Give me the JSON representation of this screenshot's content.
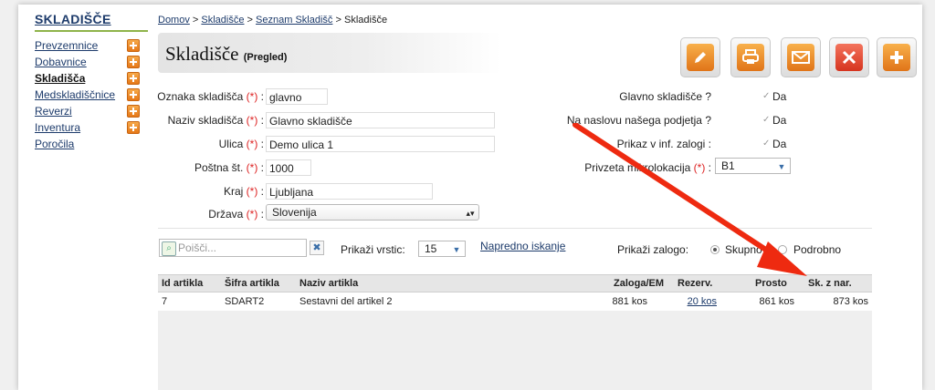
{
  "sidebar": {
    "title": "SKLADIŠČE",
    "items": [
      {
        "label": "Prevzemnice",
        "has_add": true
      },
      {
        "label": "Dobavnice",
        "has_add": true
      },
      {
        "label": "Skladišča",
        "has_add": true,
        "active": true
      },
      {
        "label": "Medskladiščnice",
        "has_add": true
      },
      {
        "label": "Reverzi",
        "has_add": true
      },
      {
        "label": "Inventura",
        "has_add": true
      },
      {
        "label": "Poročila",
        "has_add": false
      }
    ]
  },
  "breadcrumb": {
    "items": [
      "Domov",
      "Skladišče",
      "Seznam Skladišč"
    ],
    "separator": ">",
    "current": "Skladišče"
  },
  "header": {
    "title": "Skladišče",
    "subtitle": "(Pregled)"
  },
  "toolbar": {
    "buttons": [
      {
        "name": "edit",
        "icon": "pencil-icon",
        "color": "#e98a1d"
      },
      {
        "name": "print",
        "icon": "printer-icon",
        "color": "#e98a1d"
      },
      {
        "name": "email",
        "icon": "envelope-icon",
        "color": "#e98a1d"
      },
      {
        "name": "delete",
        "icon": "close-icon",
        "color": "#d9371f"
      },
      {
        "name": "add",
        "icon": "plus-icon",
        "color": "#e98a1d"
      }
    ]
  },
  "form": {
    "required_mark": "(*)",
    "oznaka": {
      "label": "Oznaka skladišča",
      "value": "glavno"
    },
    "naziv": {
      "label": "Naziv skladišča",
      "value": "Glavno skladišče"
    },
    "ulica": {
      "label": "Ulica",
      "value": "Demo ulica 1"
    },
    "postna": {
      "label": "Poštna št.",
      "value": "1000"
    },
    "kraj": {
      "label": "Kraj",
      "value": "Ljubljana"
    },
    "drzava": {
      "label": "Država",
      "value": "Slovenija"
    },
    "glavno": {
      "label": "Glavno skladišče ?",
      "value": "Da",
      "checked": true
    },
    "naslov": {
      "label": "Na naslovu našega podjetja ?",
      "value": "Da",
      "checked": true
    },
    "prikaz": {
      "label": "Prikaz v inf. zalogi :",
      "value": "Da",
      "checked": true
    },
    "mikrolokacija": {
      "label": "Privzeta mikrolokacija",
      "value": "B1"
    }
  },
  "list_controls": {
    "search_placeholder": "Poišči...",
    "rows_label": "Prikaži vrstic:",
    "rows_value": "15",
    "advanced_search": "Napredno iskanje",
    "stock_label": "Prikaži zalogo:",
    "options": [
      {
        "label": "Skupno",
        "selected": true
      },
      {
        "label": "Podrobno",
        "selected": false
      }
    ]
  },
  "table": {
    "columns": [
      "Id artikla",
      "Šifra artikla",
      "Naziv artikla",
      "Zaloga/EM",
      "Rezerv.",
      "Prosto",
      "Sk. z nar."
    ],
    "rows": [
      [
        "7",
        "SDART2",
        "Sestavni del artikel 2",
        "881 kos",
        "20 kos",
        "861 kos",
        "873 kos"
      ]
    ]
  },
  "annotation": {
    "color": "#ee2a10"
  }
}
